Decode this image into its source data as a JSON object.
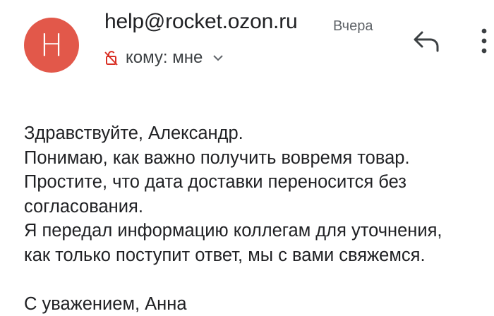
{
  "email": {
    "sender_initial": "H",
    "sender": "help@rocket.ozon.ru",
    "date": "Вчера",
    "recipient": "кому: мне",
    "colors": {
      "avatar": "#e2584a",
      "text": "#202124",
      "secondary": "#5f6368",
      "lock_icon": "#d93025"
    },
    "icons": {
      "lock": "lock-off-icon",
      "expand": "chevron-down-icon",
      "reply": "reply-icon",
      "more": "more-vert-icon"
    },
    "body": {
      "lines": [
        "Здравствуйте, Александр.",
        "Понимаю, как важно получить вовремя товар.",
        "Простите, что дата доставки переносится без",
        "согласования.",
        "Я передал информацию коллегам для уточнения,",
        "как только поступит ответ, мы с вами свяжемся."
      ],
      "signature": "С уважением, Анна"
    }
  }
}
